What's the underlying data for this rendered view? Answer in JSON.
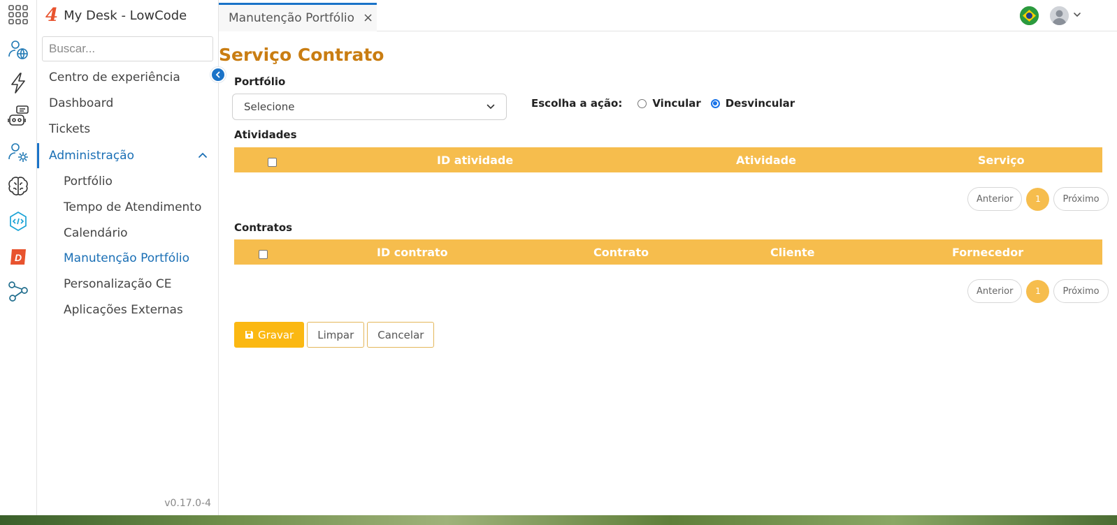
{
  "app": {
    "title": "My Desk - LowCode",
    "logo_text": "4",
    "version": "v0.17.0-4"
  },
  "rail": {
    "icons": [
      "apps-grid-icon",
      "user-globe-icon",
      "lightning-icon",
      "chatbot-icon",
      "user-settings-icon",
      "brain-icon",
      "code-hex-icon",
      "d-logo-icon",
      "share-nodes-icon"
    ],
    "d_logo_letter": "D"
  },
  "search": {
    "placeholder": "Buscar..."
  },
  "sidebar": {
    "items": [
      {
        "label": "Centro de experiência"
      },
      {
        "label": "Dashboard"
      },
      {
        "label": "Tickets"
      },
      {
        "label": "Administração"
      }
    ],
    "subitems": [
      {
        "label": "Portfólio"
      },
      {
        "label": "Tempo de Atendimento"
      },
      {
        "label": "Calendário"
      },
      {
        "label": "Manutenção Portfólio"
      },
      {
        "label": "Personalização CE"
      },
      {
        "label": "Aplicações Externas"
      }
    ]
  },
  "tabs": [
    {
      "label": "Manutenção Portfólio",
      "close": "×"
    }
  ],
  "page": {
    "title": "Serviço Contrato",
    "portfolio_label": "Portfólio",
    "portfolio_select_value": "Selecione",
    "action_label": "Escolha a ação:",
    "action_options": [
      "Vincular",
      "Desvincular"
    ],
    "action_selected": "Desvincular"
  },
  "atividades": {
    "label": "Atividades",
    "columns": [
      "ID atividade",
      "Atividade",
      "Serviço"
    ],
    "pager": {
      "prev": "Anterior",
      "page": "1",
      "next": "Próximo"
    }
  },
  "contratos": {
    "label": "Contratos",
    "columns": [
      "ID contrato",
      "Contrato",
      "Cliente",
      "Fornecedor"
    ],
    "pager": {
      "prev": "Anterior",
      "page": "1",
      "next": "Próximo"
    }
  },
  "buttons": {
    "save": "Gravar",
    "clear": "Limpar",
    "cancel": "Cancelar"
  },
  "colors": {
    "accent_blue": "#1a73c8",
    "table_header": "#f6bd4d",
    "title_orange": "#c97d12",
    "primary_button": "#fbb812"
  }
}
